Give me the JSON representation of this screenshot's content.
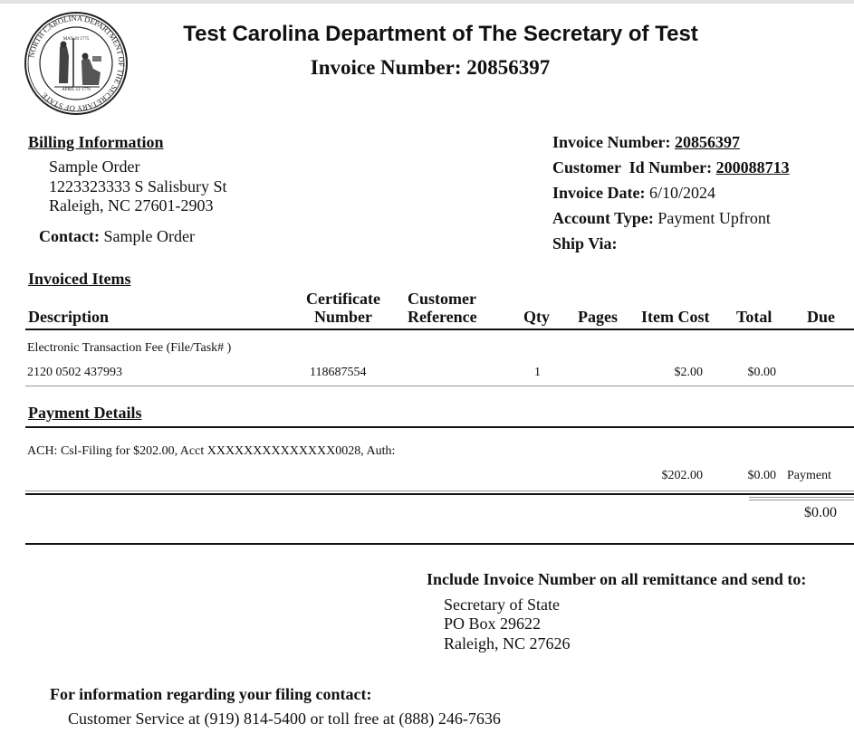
{
  "header": {
    "seal_icon": "state-seal-icon",
    "seal_text": [
      "NORTH CAROLINA DEPARTMENT OF THE SECRETARY OF STATE",
      "MAY 20 1775",
      "APRIL 12 1776"
    ],
    "title": "Test Carolina Department of The Secretary of Test",
    "subtitle": "Invoice Number: 20856397"
  },
  "billing": {
    "heading": "Billing Information",
    "name": "Sample Order",
    "street": "1223323333 S Salisbury St",
    "city_state_zip": "Raleigh, NC 27601-2903",
    "contact_label": "Contact:",
    "contact_value": "Sample Order"
  },
  "invoice_info": {
    "invoice_number_label": "Invoice Number:",
    "invoice_number": "20856397",
    "customer_id_label": "Customer  Id Number:",
    "customer_id": "200088713",
    "invoice_date_label": "Invoice Date:",
    "invoice_date": "6/10/2024",
    "account_type_label": "Account Type:",
    "account_type": "Payment Upfront",
    "ship_via_label": "Ship Via:",
    "ship_via": ""
  },
  "items": {
    "heading": "Invoiced Items",
    "columns": {
      "description": "Description",
      "certificate_1": "Certificate",
      "certificate_2": "Number",
      "customer_1": "Customer",
      "customer_2": "Reference",
      "qty": "Qty",
      "pages": "Pages",
      "item_cost": "Item Cost",
      "total": "Total",
      "due": "Due"
    },
    "rows": [
      {
        "description": "Electronic Transaction Fee  (File/Task# )",
        "file_number": "2120 0502 437993",
        "certificate_number": "118687554",
        "customer_reference": "",
        "qty": "1",
        "pages": "",
        "item_cost": "$2.00",
        "total": "$0.00",
        "due": ""
      }
    ]
  },
  "payment": {
    "heading": "Payment Details",
    "line": "ACH: Csl-Filing for $202.00,  Acct XXXXXXXXXXXXXX0028, Auth:",
    "amount": "$202.00",
    "total": "$0.00",
    "type": "Payment",
    "balance_due": "$0.00"
  },
  "remittance": {
    "heading": "Include Invoice Number on all remittance and send to:",
    "line1": "Secretary of State",
    "line2": "PO Box 29622",
    "line3": "Raleigh, NC 27626"
  },
  "contact_info": {
    "heading": "For information regarding your filing contact:",
    "line": "Customer Service at (919) 814-5400 or toll free at (888) 246-7636"
  }
}
